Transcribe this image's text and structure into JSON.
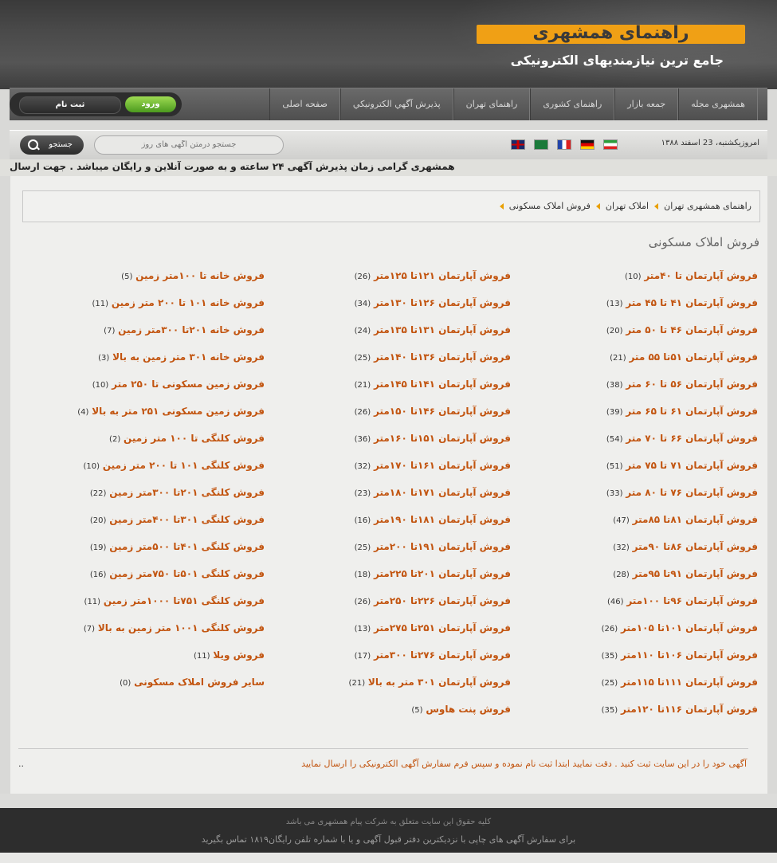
{
  "header": {
    "logo_text": "راهنمای همشهری",
    "tagline": "جامع ترین نیازمندیهای الکترونیکی"
  },
  "nav": {
    "items": [
      "صفحه اصلی",
      "پذيرش آگهي الکترونيکي",
      "راهنمای تهران",
      "راهنمای کشوری",
      "جمعه بازار",
      "همشهری مجله"
    ]
  },
  "auth": {
    "login_label": "ورود",
    "register_label": "ثبت نام"
  },
  "infobar": {
    "date": "امروزیکشنبه، 23 اسفند ۱۳۸۸",
    "flags": [
      "iran-flag-icon",
      "germany-flag-icon",
      "france-flag-icon",
      "saudi-flag-icon",
      "uk-flag-icon"
    ],
    "search_placeholder": "جستجو درمتن آگهی های روز",
    "search_button": "جستجو"
  },
  "ticker": {
    "text": "همشهری گرامی زمان پذیرش آگهی ۲۴ ساعته و به صورت آنلاین و رایگان میباشد . جهت ارسال"
  },
  "breadcrumb": {
    "items": [
      "راهنمای همشهری تهران",
      "املاک تهران",
      "فروش املاک مسکونی"
    ]
  },
  "page_title": "فروش املاک مسکونی",
  "columns": [
    [
      {
        "label": "فروش آپارتمان تا ۴۰متر",
        "count": "(10)"
      },
      {
        "label": "فروش آپارتمان ۴۱ تا ۴۵ متر",
        "count": "(13)"
      },
      {
        "label": "فروش آپارتمان ۴۶ تا ۵۰ متر",
        "count": "(20)"
      },
      {
        "label": "فروش آپارتمان ۵۱تا ۵۵ متر",
        "count": "(21)"
      },
      {
        "label": "فروش آپارتمان ۵۶ تا ۶۰ متر",
        "count": "(38)"
      },
      {
        "label": "فروش آپارتمان ۶۱ تا ۶۵ متر",
        "count": "(39)"
      },
      {
        "label": "فروش آپارتمان ۶۶ تا ۷۰ متر",
        "count": "(54)"
      },
      {
        "label": "فروش آپارتمان ۷۱ تا ۷۵ متر",
        "count": "(51)"
      },
      {
        "label": "فروش آپارتمان ۷۶ تا ۸۰ متر",
        "count": "(33)"
      },
      {
        "label": "فروش آپارتمان ۸۱تا ۸۵متر",
        "count": "(47)"
      },
      {
        "label": "فروش آپارتمان ۸۶تا ۹۰متر",
        "count": "(32)"
      },
      {
        "label": "فروش آپارتمان ۹۱تا ۹۵متر",
        "count": "(28)"
      },
      {
        "label": "فروش آپارتمان ۹۶تا ۱۰۰متر",
        "count": "(46)"
      },
      {
        "label": "فروش آپارتمان ۱۰۱تا ۱۰۵متر",
        "count": "(26)"
      },
      {
        "label": "فروش آپارتمان ۱۰۶تا ۱۱۰متر",
        "count": "(35)"
      },
      {
        "label": "فروش آپارتمان ۱۱۱تا ۱۱۵متر",
        "count": "(25)"
      },
      {
        "label": "فروش آپارتمان ۱۱۶تا ۱۲۰متر",
        "count": "(35)"
      }
    ],
    [
      {
        "label": "فروش آپارتمان ۱۲۱تا ۱۲۵متر",
        "count": "(26)"
      },
      {
        "label": "فروش آپارتمان ۱۲۶تا ۱۳۰متر",
        "count": "(34)"
      },
      {
        "label": "فروش آپارتمان ۱۳۱تا ۱۳۵متر",
        "count": "(24)"
      },
      {
        "label": "فروش آپارتمان ۱۳۶تا ۱۴۰متر",
        "count": "(25)"
      },
      {
        "label": "فروش آپارتمان ۱۴۱تا ۱۴۵متر",
        "count": "(21)"
      },
      {
        "label": "فروش آپارتمان ۱۴۶تا ۱۵۰متر",
        "count": "(26)"
      },
      {
        "label": "فروش آپارتمان ۱۵۱تا ۱۶۰متر",
        "count": "(36)"
      },
      {
        "label": "فروش آپارتمان ۱۶۱تا ۱۷۰متر",
        "count": "(32)"
      },
      {
        "label": "فروش آپارتمان ۱۷۱تا ۱۸۰متر",
        "count": "(23)"
      },
      {
        "label": "فروش آپارتمان ۱۸۱تا ۱۹۰متر",
        "count": "(16)"
      },
      {
        "label": "فروش آپارتمان ۱۹۱تا ۲۰۰متر",
        "count": "(25)"
      },
      {
        "label": "فروش آپارتمان ۲۰۱تا ۲۲۵متر",
        "count": "(18)"
      },
      {
        "label": "فروش آپارتمان ۲۲۶تا ۲۵۰متر",
        "count": "(26)"
      },
      {
        "label": "فروش آپارتمان ۲۵۱تا ۲۷۵متر",
        "count": "(13)"
      },
      {
        "label": "فروش آپارتمان ۲۷۶تا ۳۰۰متر",
        "count": "(17)"
      },
      {
        "label": "فروش آپارتمان ۳۰۱ متر به بالا",
        "count": "(21)"
      },
      {
        "label": "فروش پنت هاوس",
        "count": "(5)"
      }
    ],
    [
      {
        "label": "فروش خانه تا ۱۰۰متر زمین",
        "count": "(5)"
      },
      {
        "label": "فروش خانه ۱۰۱ تا ۲۰۰ متر زمین",
        "count": "(11)"
      },
      {
        "label": "فروش خانه ۲۰۱تا ۳۰۰متر زمین",
        "count": "(7)"
      },
      {
        "label": "فروش خانه ۳۰۱ متر زمین به بالا",
        "count": "(3)"
      },
      {
        "label": "فروش زمین مسکونی تا ۲۵۰ متر",
        "count": "(10)"
      },
      {
        "label": "فروش زمین مسکونی ۲۵۱ متر به بالا",
        "count": "(4)"
      },
      {
        "label": "فروش کلنگی تا ۱۰۰ متر زمین",
        "count": "(2)"
      },
      {
        "label": "فروش کلنگی ۱۰۱ تا ۲۰۰ متر زمین",
        "count": "(10)"
      },
      {
        "label": "فروش کلنگی ۲۰۱تا ۳۰۰متر زمین",
        "count": "(22)"
      },
      {
        "label": "فروش کلنگی ۳۰۱تا ۴۰۰متر زمین",
        "count": "(20)"
      },
      {
        "label": "فروش کلنگی ۴۰۱تا ۵۰۰متر زمین",
        "count": "(19)"
      },
      {
        "label": "فروش کلنگی ۵۰۱تا ۷۵۰متر زمین",
        "count": "(16)"
      },
      {
        "label": "فروش کلنگی ۷۵۱تا ۱۰۰۰متر زمین",
        "count": "(11)"
      },
      {
        "label": "فروش کلنگی ۱۰۰۱ متر زمین به بالا",
        "count": "(7)"
      },
      {
        "label": "فروش ویلا",
        "count": "(11)"
      },
      {
        "label": "سایر فروش املاک مسکونی",
        "count": "(0)"
      }
    ]
  ],
  "notice": "آگهی خود را در این سایت ثبت کنید . دقت نمایید ابتدا ثبت نام نموده و سپس فرم سفارش آگهی الکترونیکی را ارسال نمایید",
  "dots": "..",
  "footer": {
    "copyright": "کلیه حقوق این سایت متعلق به شرکت پیام همشهری می باشد",
    "contact": "برای سفارش آگهی های چاپی با نزدیکترین دفتر قبول آگهی و یا با شماره تلفن رایگان۱۸۱۹ تماس بگیرید"
  }
}
